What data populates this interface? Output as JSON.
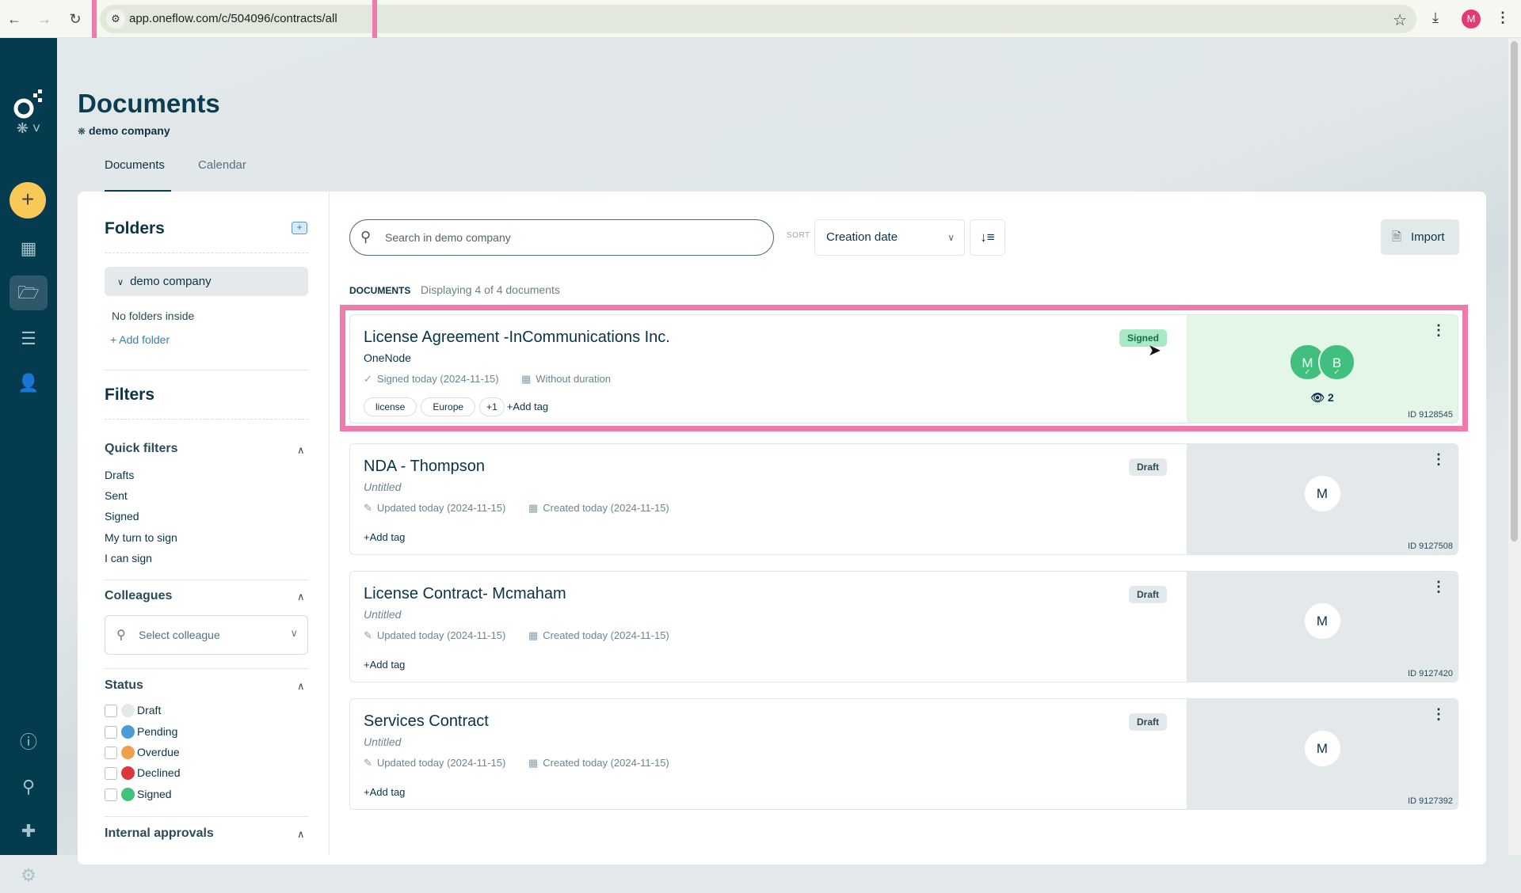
{
  "browser": {
    "url": "app.oneflow.com/c/504096/contracts/all",
    "profile_initial": "M"
  },
  "rail": {
    "items": [
      "workspace-switcher",
      "create",
      "dashboard",
      "documents",
      "templates",
      "address-book",
      "help",
      "search",
      "marketplace",
      "settings"
    ]
  },
  "header": {
    "title": "Documents",
    "workspace": "demo company",
    "tabs": [
      {
        "label": "Documents",
        "active": true
      },
      {
        "label": "Calendar",
        "active": false
      }
    ]
  },
  "folders": {
    "title": "Folders",
    "root": "demo company",
    "empty_text": "No folders inside",
    "add_label": "+ Add folder"
  },
  "filters": {
    "title": "Filters",
    "quick": {
      "title": "Quick filters",
      "items": [
        "Drafts",
        "Sent",
        "Signed",
        "My turn to sign",
        "I can sign"
      ]
    },
    "colleagues": {
      "title": "Colleagues",
      "placeholder": "Select colleague"
    },
    "status": {
      "title": "Status",
      "items": [
        {
          "label": "Draft",
          "color": "#e3e8ea",
          "checked": false
        },
        {
          "label": "Pending",
          "color": "#4d9bd6",
          "checked": false
        },
        {
          "label": "Overdue",
          "color": "#f0a04b",
          "checked": false
        },
        {
          "label": "Declined",
          "color": "#d9383e",
          "checked": false
        },
        {
          "label": "Signed",
          "color": "#3fc27a",
          "checked": false
        }
      ]
    },
    "internal_approvals": {
      "title": "Internal approvals"
    }
  },
  "toolbar": {
    "search_placeholder": "Search in demo company",
    "sort_label": "SORT",
    "sort_value": "Creation date",
    "import_label": "Import"
  },
  "list": {
    "heading": "DOCUMENTS",
    "count_text": "Displaying 4 of 4 documents"
  },
  "documents": [
    {
      "title": "License Agreement -InCommunications Inc.",
      "subtitle": "OneNode",
      "meta1": "Signed today (2024-11-15)",
      "meta2": "Without duration",
      "tags": [
        "license",
        "Europe",
        "+1"
      ],
      "add_tag": "+Add tag",
      "status": "Signed",
      "participants": [
        "M",
        "B"
      ],
      "viewers": "2",
      "id": "ID 9128545"
    },
    {
      "title": "NDA - Thompson",
      "subtitle": "Untitled",
      "meta1": "Updated today (2024-11-15)",
      "meta2": "Created today (2024-11-15)",
      "tags": [],
      "add_tag": "+Add tag",
      "status": "Draft",
      "participants": [
        "M"
      ],
      "id": "ID 9127508"
    },
    {
      "title": "License Contract- Mcmaham",
      "subtitle": "Untitled",
      "meta1": "Updated today (2024-11-15)",
      "meta2": "Created today (2024-11-15)",
      "tags": [],
      "add_tag": "+Add tag",
      "status": "Draft",
      "participants": [
        "M"
      ],
      "id": "ID 9127420"
    },
    {
      "title": "Services Contract",
      "subtitle": "Untitled",
      "meta1": "Updated today (2024-11-15)",
      "meta2": "Created today (2024-11-15)",
      "tags": [],
      "add_tag": "+Add tag",
      "status": "Draft",
      "participants": [
        "M"
      ],
      "id": "ID 9127392"
    }
  ]
}
